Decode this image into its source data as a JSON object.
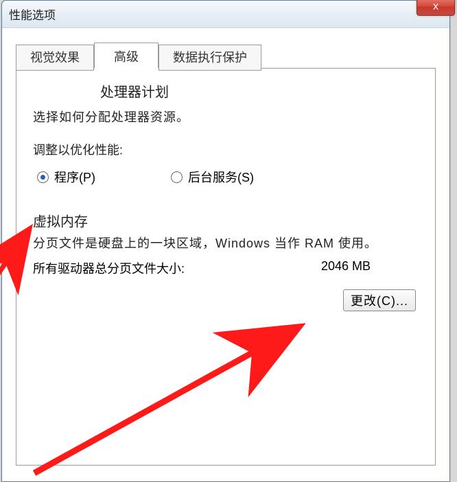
{
  "window": {
    "title": "性能选项",
    "close_label": "x"
  },
  "tabs": {
    "visual": "视觉效果",
    "advanced": "高级",
    "dep": "数据执行保护"
  },
  "processor": {
    "heading": "处理器计划",
    "desc": "选择如何分配处理器资源。",
    "adjust_label": "调整以优化性能:",
    "programs": "程序(P)",
    "services": "后台服务(S)"
  },
  "vm": {
    "heading": "虚拟内存",
    "desc": "分页文件是硬盘上的一块区域，Windows 当作 RAM 使用。",
    "total_label": "所有驱动器总分页文件大小:",
    "total_value": "2046 MB",
    "change_btn": "更改(C)..."
  }
}
